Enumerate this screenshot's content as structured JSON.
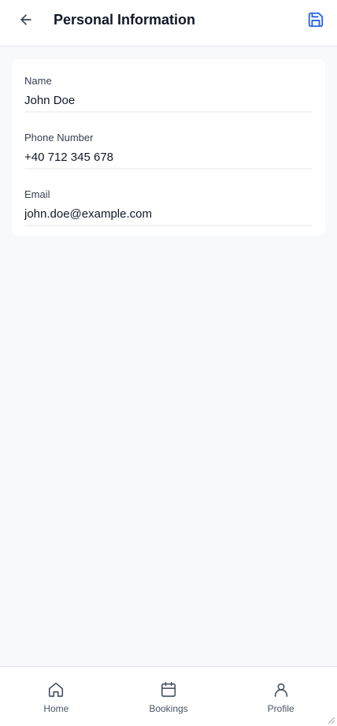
{
  "header": {
    "title": "Personal Information",
    "back_icon": "arrow-left-icon",
    "save_icon": "save-icon"
  },
  "form": {
    "fields": [
      {
        "label": "Name",
        "value": "John Doe"
      },
      {
        "label": "Phone Number",
        "value": "+40 712 345 678"
      },
      {
        "label": "Email",
        "value": "john.doe@example.com"
      }
    ]
  },
  "nav": {
    "items": [
      {
        "label": "Home",
        "icon": "home-icon"
      },
      {
        "label": "Bookings",
        "icon": "calendar-icon"
      },
      {
        "label": "Profile",
        "icon": "user-icon"
      }
    ]
  },
  "colors": {
    "accent": "#2563eb",
    "background": "#f8f9fb",
    "text": "#111827"
  }
}
